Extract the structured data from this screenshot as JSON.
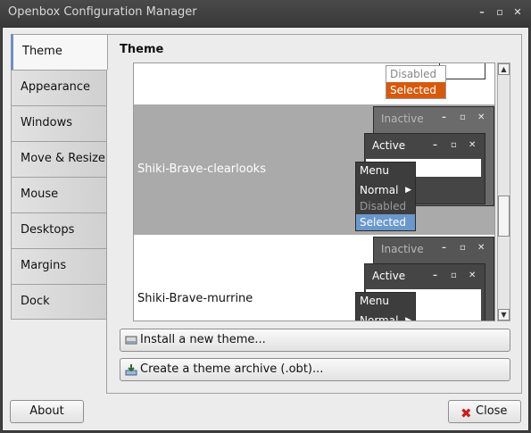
{
  "window": {
    "title": "Openbox Configuration Manager",
    "minimize_icon": "minimize-icon",
    "maximize_icon": "maximize-icon",
    "close_icon": "close-icon"
  },
  "tabs": [
    {
      "label": "Theme",
      "active": true
    },
    {
      "label": "Appearance"
    },
    {
      "label": "Windows"
    },
    {
      "label": "Move & Resize"
    },
    {
      "label": "Mouse"
    },
    {
      "label": "Desktops"
    },
    {
      "label": "Margins"
    },
    {
      "label": "Dock"
    }
  ],
  "page": {
    "title": "Theme"
  },
  "theme_list": {
    "items": [
      {
        "name": "",
        "preview": {
          "menu": [
            "Disabled",
            "Selected"
          ]
        }
      },
      {
        "name": "Shiki-Brave-clearlooks",
        "selected": true,
        "preview": {
          "inactive_label": "Inactive",
          "active_label": "Active",
          "menu": [
            "Menu",
            "Normal",
            "Disabled",
            "Selected"
          ]
        }
      },
      {
        "name": "Shiki-Brave-murrine",
        "preview": {
          "inactive_label": "Inactive",
          "active_label": "Active",
          "menu": [
            "Menu",
            "Normal"
          ]
        }
      }
    ]
  },
  "buttons": {
    "install": "Install a new theme...",
    "archive": "Create a theme archive (.obt)...",
    "about": "About",
    "close": "Close"
  },
  "colors": {
    "accent_selected": "#6a98cc",
    "selected_orange": "#d65a0d",
    "selected_row": "#aaaaaa"
  }
}
